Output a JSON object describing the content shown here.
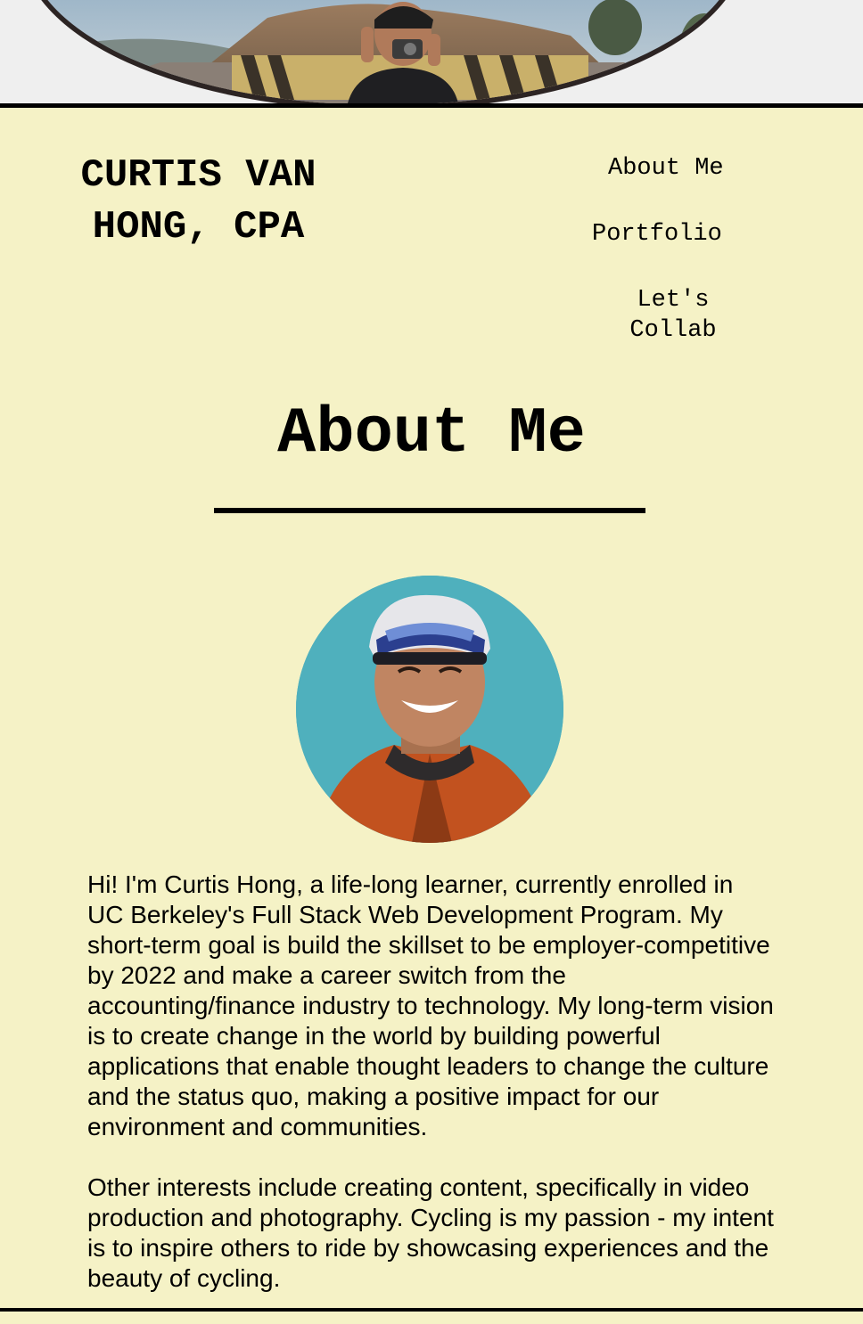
{
  "header": {
    "title": "CURTIS VAN HONG, CPA"
  },
  "nav": {
    "items": [
      {
        "label": "About Me"
      },
      {
        "label": "Portfolio"
      },
      {
        "label": "Let's Collab"
      }
    ]
  },
  "about": {
    "heading": "About Me",
    "paragraphs": [
      "Hi! I'm Curtis Hong, a life-long learner, currently enrolled in UC Berkeley's Full Stack Web Development Program. My short-term goal is build the skillset to be employer-competitive by 2022 and make a career switch from the accounting/finance industry to technology. My long-term vision is to create change in the world by building powerful applications that enable thought leaders to change the culture and the status quo, making a positive impact for our environment and communities.",
      "Other interests include creating content, specifically in video production and photography. Cycling is my passion - my intent is to inspire others to ride by showcasing experiences and the beauty of cycling."
    ]
  },
  "colors": {
    "background": "#f5f2c6",
    "text": "#000000",
    "portrait_background": "#4fb0bd"
  }
}
